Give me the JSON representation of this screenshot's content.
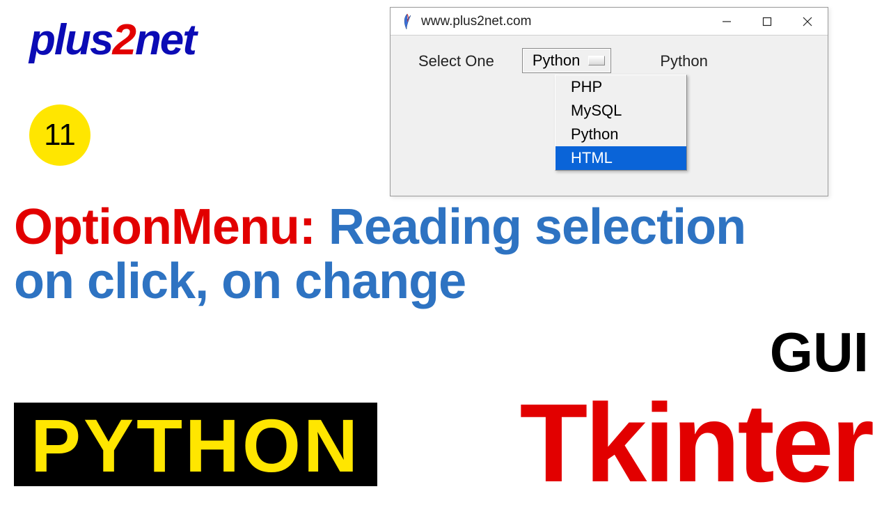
{
  "logo": {
    "part1": "plus",
    "part2": "2",
    "part3": "net"
  },
  "badge": {
    "number": "11"
  },
  "headline": {
    "red": "OptionMenu:",
    "blue1": " Reading selection",
    "blue2": "on click, on change"
  },
  "labels": {
    "gui": "GUI",
    "python": "PYTHON",
    "tkinter": "Tkinter"
  },
  "window": {
    "title": "www.plus2net.com",
    "prompt": "Select One",
    "selected_value": "Python",
    "result_label": "Python",
    "menu_items": [
      "PHP",
      "MySQL",
      "Python",
      "HTML"
    ],
    "highlighted": "HTML"
  }
}
